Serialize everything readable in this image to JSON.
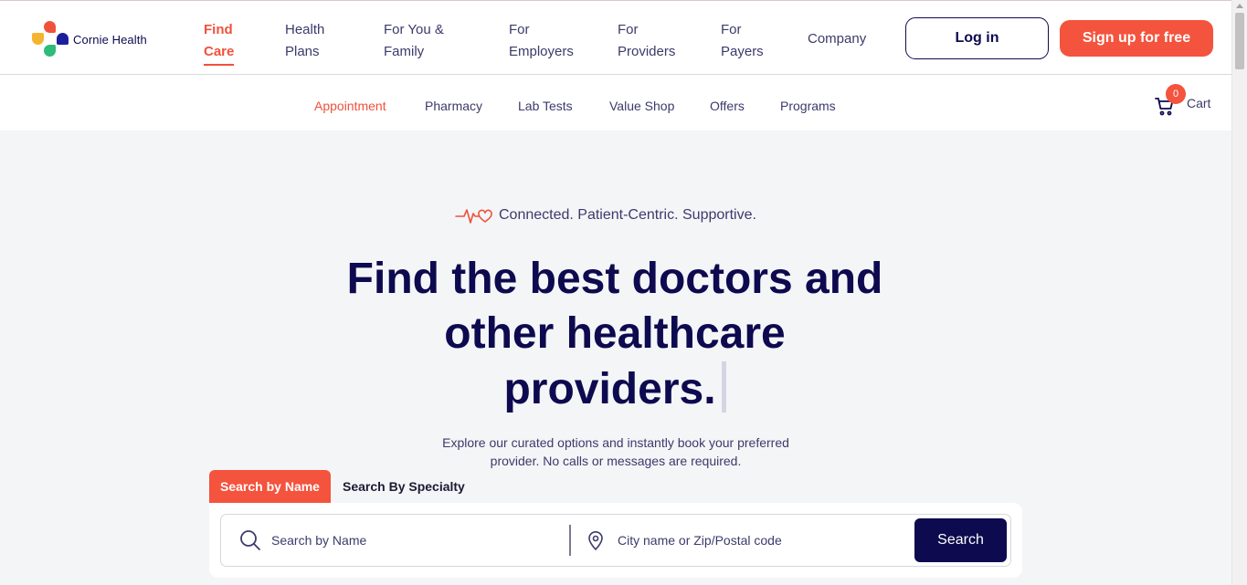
{
  "brand": {
    "name": "Cornie Health"
  },
  "nav": {
    "items": [
      {
        "line1": "Find",
        "line2": "Care"
      },
      {
        "line1": "Health",
        "line2": "Plans"
      },
      {
        "line1": "For You &",
        "line2": "Family"
      },
      {
        "line1": "For",
        "line2": "Employers"
      },
      {
        "line1": "For",
        "line2": "Providers"
      },
      {
        "line1": "For",
        "line2": "Payers"
      },
      {
        "line1": "Company"
      }
    ],
    "login_label": "Log in",
    "signup_label": "Sign up for free"
  },
  "subnav": {
    "items": [
      "Appointment",
      "Pharmacy",
      "Lab Tests",
      "Value Shop",
      "Offers",
      "Programs"
    ],
    "cart_label": "Cart",
    "cart_count": "0"
  },
  "hero": {
    "tagline": "Connected. Patient-Centric. Supportive.",
    "title_line1": "Find the best doctors and",
    "title_line2": "other healthcare",
    "title_line3": "providers.",
    "subtitle": "Explore our curated options and instantly book your preferred provider. No calls or messages are required."
  },
  "search": {
    "tab_name": "Search by Name",
    "tab_specialty": "Search By Specialty",
    "name_placeholder": "Search by Name",
    "location_placeholder": "City name or Zip/Postal code",
    "button_label": "Search"
  },
  "colors": {
    "accent": "#f4533d",
    "navy": "#0d0a4f",
    "background": "#f4f5f7"
  },
  "icons": [
    "logo-mark",
    "cart-icon",
    "heartbeat-icon",
    "search-icon",
    "location-pin-icon"
  ]
}
